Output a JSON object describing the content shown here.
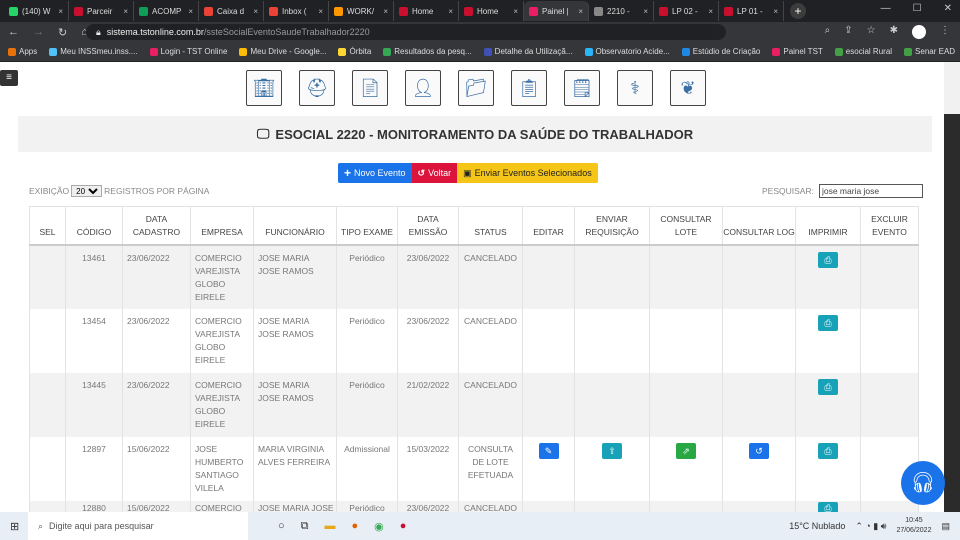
{
  "browser": {
    "tabs": [
      {
        "label": "(140) W",
        "color": "#25d366"
      },
      {
        "label": "Parceir",
        "color": "#c8102e"
      },
      {
        "label": "ACOMP",
        "color": "#0f9d58"
      },
      {
        "label": "Caixa d",
        "color": "#ea4335"
      },
      {
        "label": "Inbox (",
        "color": "#ea4335"
      },
      {
        "label": "WORK/",
        "color": "#ff9800"
      },
      {
        "label": "Home",
        "color": "#c8102e"
      },
      {
        "label": "Home",
        "color": "#c8102e"
      },
      {
        "label": "Painel |",
        "color": "#e91e63",
        "active": true
      },
      {
        "label": "2210 -",
        "color": "#888888"
      },
      {
        "label": "LP 02 -",
        "color": "#c8102e"
      },
      {
        "label": "LP 01 -",
        "color": "#c8102e"
      }
    ],
    "url_host": "sistema.tstonline.com.br",
    "url_path": "/ssteSocialEventoSaudeTrabalhador2220",
    "bookmarks": [
      {
        "label": "Apps",
        "color": "#e8710a"
      },
      {
        "label": "Meu INSSmeu.inss....",
        "color": "#4fc3f7"
      },
      {
        "label": "Login - TST Online",
        "color": "#e91e63"
      },
      {
        "label": "Meu Drive - Google...",
        "color": "#fbbc04"
      },
      {
        "label": "Órbita",
        "color": "#fdd835"
      },
      {
        "label": "Resultados da pesq...",
        "color": "#34a853"
      },
      {
        "label": "Detalhe da Utilizaçã...",
        "color": "#3f51b5"
      },
      {
        "label": "Observatorio Acide...",
        "color": "#29b6f6"
      },
      {
        "label": "Estúdio de Criação",
        "color": "#1e88e5"
      },
      {
        "label": "Painel TST",
        "color": "#e91e63"
      },
      {
        "label": "esocial Rural",
        "color": "#43a047"
      },
      {
        "label": "Senar EAD",
        "color": "#43a047"
      }
    ]
  },
  "page": {
    "menu_icons": [
      "building-icon",
      "helmet-icon",
      "document-icon",
      "doctor-icon",
      "folder-icon",
      "clipboard-icon",
      "medical-record-icon",
      "physician-icon",
      "hands-plant-icon"
    ],
    "title": "ESOCIAL 2220 - MONITORAMENTO DA SAÚDE DO TRABALHADOR",
    "buttons": {
      "novo": "Novo Evento",
      "voltar": "Voltar",
      "enviar": "Enviar Eventos Selecionados"
    },
    "exibicao": "EXIBIÇÃO",
    "per_page": "20",
    "registros": "REGISTROS POR PÁGINA",
    "search_label": "PESQUISAR:",
    "search_value": "jose maria jose",
    "columns": [
      "SEL",
      "CÓDIGO",
      "DATA CADASTRO",
      "EMPRESA",
      "FUNCIONÁRIO",
      "TIPO EXAME",
      "DATA EMISSÃO",
      "STATUS",
      "EDITAR",
      "ENVIAR REQUISIÇÃO",
      "CONSULTAR LOTE",
      "CONSULTAR LOG",
      "IMPRIMIR",
      "EXCLUIR EVENTO"
    ],
    "rows": [
      {
        "codigo": "13461",
        "cadastro": "23/06/2022",
        "empresa": "COMERCIO VAREJISTA GLOBO EIRELE",
        "funcionario": "JOSE MARIA JOSE RAMOS",
        "tipo": "Periódico",
        "emissao": "23/06/2022",
        "status": "CANCELADO",
        "actions": false
      },
      {
        "codigo": "13454",
        "cadastro": "23/06/2022",
        "empresa": "COMERCIO VAREJISTA GLOBO EIRELE",
        "funcionario": "JOSE MARIA JOSE RAMOS",
        "tipo": "Periódico",
        "emissao": "23/06/2022",
        "status": "CANCELADO",
        "actions": false
      },
      {
        "codigo": "13445",
        "cadastro": "23/06/2022",
        "empresa": "COMERCIO VAREJISTA GLOBO EIRELE",
        "funcionario": "JOSE MARIA JOSE RAMOS",
        "tipo": "Periódico",
        "emissao": "21/02/2022",
        "status": "CANCELADO",
        "actions": false
      },
      {
        "codigo": "12897",
        "cadastro": "15/06/2022",
        "empresa": "JOSE HUMBERTO SANTIAGO VILELA",
        "funcionario": "MARIA VIRGINIA ALVES FERREIRA",
        "tipo": "Admissional",
        "emissao": "15/03/2022",
        "status": "CONSULTA DE LOTE EFETUADA",
        "actions": true
      },
      {
        "codigo": "12880",
        "cadastro": "15/06/2022",
        "empresa": "COMERCIO",
        "funcionario": "JOSE MARIA JOSE",
        "tipo": "Periódico",
        "emissao": "23/06/2022",
        "status": "CANCELADO",
        "actions": false
      }
    ],
    "colors": {
      "blue": "#1a73e8",
      "red": "#dc143c",
      "yellow": "#f5c518",
      "teal": "#17a2b8",
      "green": "#28a745"
    }
  },
  "taskbar": {
    "search_placeholder": "Digite aqui para pesquisar",
    "weather": "15°C  Nublado",
    "time": "10:45",
    "date": "27/06/2022"
  }
}
